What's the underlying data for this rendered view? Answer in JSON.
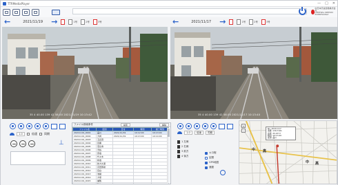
{
  "titlebar": {
    "title": "TTRMediaPlayer",
    "min": "—",
    "max": "□",
    "close": "✕"
  },
  "brand": {
    "line1": "中日本高速道路株式会社",
    "line2": "CENTRAL NIPPON EXPRESSWAY"
  },
  "left_nav": {
    "date": "2021/11/19",
    "doc1": "1号",
    "doc2": "2号",
    "doc3": "3号"
  },
  "right_nav": {
    "date": "2021/11/17",
    "doc1": "1号",
    "doc2": "2号",
    "doc3": "3号"
  },
  "left_video": {
    "osd": "35 4 40.00  139 42 58.00  2021/11/19  10:13:42"
  },
  "right_video": {
    "osd": "35 4 40.00  139 42 58.00  2021/11/17  10:13:40"
  },
  "controls": {
    "speed_value": "1.0",
    "speed_label": "倍速",
    "sync_label": "同期"
  },
  "table": {
    "header_label": "ファイル検索条件",
    "btn_search": "検索",
    "btn_clear": "解除",
    "columns": [
      "ファイル名",
      "区間",
      "日付",
      "時刻",
      "終了時刻"
    ],
    "rows": [
      [
        "20211119_0001",
        "品川",
        "2021/11/19",
        "10:12:00",
        "10:13:00"
      ],
      [
        "20211119_0002",
        "大崎",
        "2021/11/19",
        "10:13:00",
        "10:14:00"
      ],
      [
        "20211119_0003",
        "五反田",
        "",
        "",
        ""
      ],
      [
        "20211119_0004",
        "目黒",
        "",
        "",
        ""
      ],
      [
        "20211119_0005",
        "恵比寿",
        "",
        "",
        ""
      ],
      [
        "20211119_0006",
        "渋谷",
        "",
        "",
        ""
      ],
      [
        "20211119_0007",
        "原宿",
        "",
        "",
        ""
      ],
      [
        "20211119_0008",
        "代々木",
        "",
        "",
        ""
      ],
      [
        "20211119_0009",
        "新宿",
        "",
        "",
        ""
      ],
      [
        "20211119_0010",
        "新大久保",
        "",
        "",
        ""
      ],
      [
        "20211119_0011",
        "高田馬場",
        "",
        "",
        ""
      ],
      [
        "20211119_0012",
        "目白",
        "",
        "",
        ""
      ],
      [
        "20211119_0013",
        "池袋",
        "",
        "",
        ""
      ],
      [
        "20211119_0014",
        "大塚",
        "",
        "",
        ""
      ],
      [
        "20211119_0015",
        "巣鴨",
        "",
        "",
        ""
      ],
      [
        "20211119_0016",
        "駒込",
        "",
        "",
        ""
      ],
      [
        "20211119_0017",
        "田端",
        "",
        "",
        ""
      ],
      [
        "20211119_0018",
        "西日暮里",
        "",
        "",
        ""
      ]
    ]
  },
  "right_controls": {
    "speed_value": "1.0",
    "btn_a": "倍速",
    "btn_b": "同期",
    "list": [
      "1 左側",
      "2 右側",
      "3 前方",
      "4 後方"
    ],
    "opts": [
      "キロ程",
      "区間",
      "GPS地図",
      "速度"
    ]
  },
  "map": {
    "popup_lines": [
      "No. 20211117",
      "東経: 139.7161",
      "北緯: 35.0777",
      "時刻: 10:13:40",
      "区間: 品川"
    ],
    "labels": [
      "中",
      "高",
      "中",
      "高"
    ],
    "zoom_in": "+",
    "zoom_out": "−"
  }
}
